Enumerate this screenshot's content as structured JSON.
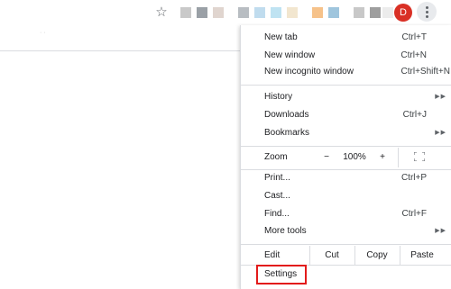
{
  "toolbar": {
    "bookmark_icon": "star-icon",
    "avatar_letter": "D",
    "avatar_color": "#d93025",
    "menu_icon": "more-vert-icon",
    "extension_colors": [
      "#c9c9c9",
      "#9aa0a6",
      "#e0d5cf",
      "#b8bdc2",
      "#c0dcee",
      "#bfe3f2",
      "#f2e6cf",
      "#f6c28a",
      "#9fc5dd",
      "#c8c8c8",
      "#9e9e9e",
      "#ececec"
    ]
  },
  "menu": {
    "new_tab": {
      "label": "New tab",
      "shortcut": "Ctrl+T"
    },
    "new_window": {
      "label": "New window",
      "shortcut": "Ctrl+N"
    },
    "new_incognito": {
      "label": "New incognito window",
      "shortcut": "Ctrl+Shift+N"
    },
    "history": {
      "label": "History"
    },
    "downloads": {
      "label": "Downloads",
      "shortcut": "Ctrl+J"
    },
    "bookmarks": {
      "label": "Bookmarks"
    },
    "zoom": {
      "label": "Zoom",
      "minus": "−",
      "level": "100%",
      "plus": "+"
    },
    "print": {
      "label": "Print...",
      "shortcut": "Ctrl+P"
    },
    "cast": {
      "label": "Cast..."
    },
    "find": {
      "label": "Find...",
      "shortcut": "Ctrl+F"
    },
    "more_tools": {
      "label": "More tools"
    },
    "edit": {
      "label": "Edit",
      "cut": "Cut",
      "copy": "Copy",
      "paste": "Paste"
    },
    "settings": {
      "label": "Settings",
      "highlight_color": "#e21b1b"
    }
  }
}
